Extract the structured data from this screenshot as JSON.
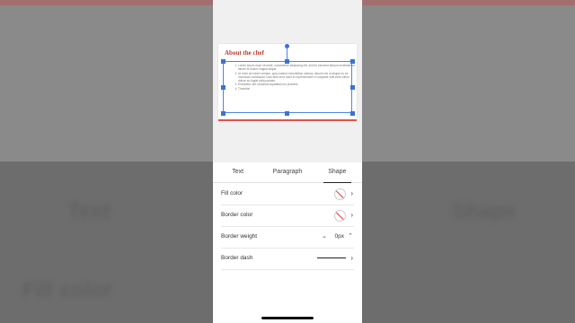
{
  "slide": {
    "title": "About the chef",
    "items": [
      "Lorem ipsum dolor sit amet, consectetur adipiscing elit, sed do eiusmod tempor incididunt ut labore et dolore magna aliqua.",
      "Ut enim ad minim veniam, quis nostrud exercitation ullamco laboris nisi ut aliquip ex ea commodo consequat. Duis aute irure dolor in reprehenderit in voluptate velit esse cillum dolore eu fugiat nulla pariatur.",
      "Excepteur sint occaecat cupidatat non proident.",
      "Thumbtin"
    ]
  },
  "tabs": [
    {
      "label": "Text",
      "active": false
    },
    {
      "label": "Paragraph",
      "active": false
    },
    {
      "label": "Shape",
      "active": true
    }
  ],
  "rows": {
    "fill_color": {
      "label": "Fill color"
    },
    "border_color": {
      "label": "Border color"
    },
    "border_weight": {
      "label": "Border weight",
      "value": "0px"
    },
    "border_dash": {
      "label": "Border dash"
    }
  },
  "background": {
    "left_text_1": "Text",
    "right_text_1": "Shape",
    "left_text_2": "Fill color"
  },
  "icons": {
    "chevron": "chevron-right-icon",
    "down": "chevron-down-icon",
    "up": "chevron-up-icon",
    "no_color": "no-color-swatch-icon"
  }
}
